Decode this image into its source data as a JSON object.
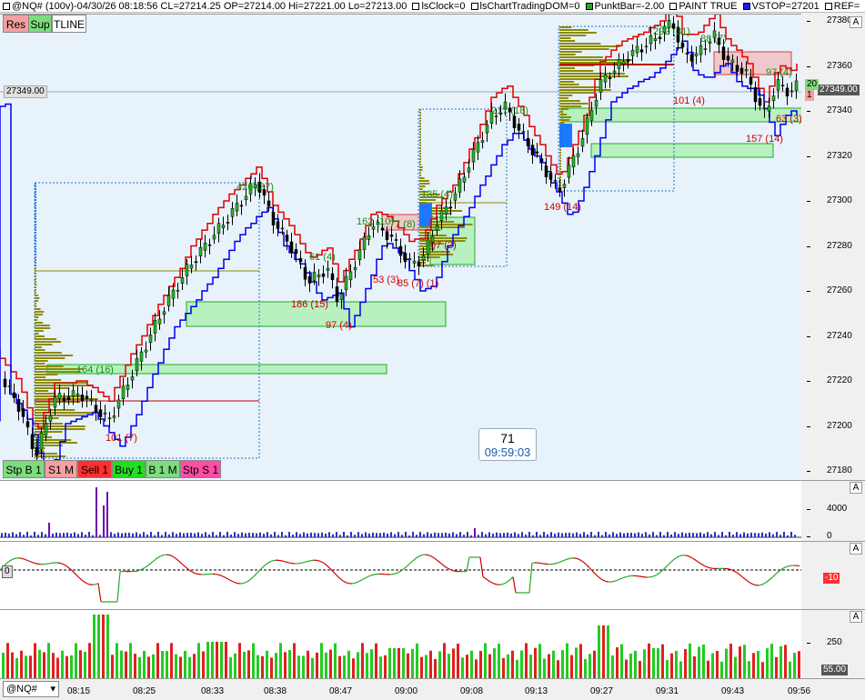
{
  "info_bar": {
    "symbol_text": "@NQ# (100v)-04/30/26 08:18:56 CL=27214.25 OP=27214.00 Hi=27221.00 Lo=27213.00",
    "items": [
      {
        "label": "lsClock=0",
        "color": "#ffffff"
      },
      {
        "label": "lsChartTradingDOM=0",
        "color": "#ffffff"
      },
      {
        "label": "PunktBar=-2.00",
        "color": "#22aa22"
      },
      {
        "label": "PAINT TRUE",
        "color": "#ffffff"
      },
      {
        "label": "VSTOP=27201",
        "color": "#1a1aff"
      },
      {
        "label": "REF=",
        "color": "#ffffff"
      }
    ]
  },
  "top_buttons": [
    {
      "label": "Res",
      "color": "#f4a0a0"
    },
    {
      "label": "Sup",
      "color": "#7ddc7d"
    },
    {
      "label": "TLINE",
      "color": "#ffffff"
    }
  ],
  "order_buttons": [
    {
      "label": "Stp B 1",
      "color": "#7ddc7d"
    },
    {
      "label": "S1 M",
      "color": "#f4a0a0"
    },
    {
      "label": "Sell 1",
      "color": "#ff3030"
    },
    {
      "label": "Buy 1",
      "color": "#22dd22"
    },
    {
      "label": "B 1 M",
      "color": "#7ddc7d"
    },
    {
      "label": "Stp S 1",
      "color": "#ff4da6"
    }
  ],
  "timer": {
    "count": "71",
    "time": "09:59:03"
  },
  "price_marker": "27349.00",
  "last_price": "27349.00",
  "right_tags": {
    "green": "20",
    "pink": "1"
  },
  "price_axis": {
    "ticks": [
      "27380",
      "27360",
      "27340",
      "27320",
      "27300",
      "27280",
      "27260",
      "27240",
      "27220",
      "27200",
      "27180"
    ],
    "button": "A"
  },
  "delta_axis": {
    "ticks": [
      "4000",
      "0"
    ],
    "button": "A"
  },
  "osc_axis": {
    "tag": "-10",
    "button": "A",
    "left_tag": "0"
  },
  "vol_axis": {
    "ticks": [
      "250"
    ],
    "tag": "55.00",
    "button": "A"
  },
  "swing_labels": [
    {
      "text": "426 (37)",
      "color": "green"
    },
    {
      "text": "164 (16)",
      "color": "green"
    },
    {
      "text": "101 (7)",
      "color": "red"
    },
    {
      "text": "61 (4)",
      "color": "green"
    },
    {
      "text": "186 (15)",
      "color": "red"
    },
    {
      "text": "97 (4)",
      "color": "red"
    },
    {
      "text": "162 (10)",
      "color": "green"
    },
    {
      "text": "77 (8)",
      "color": "green"
    },
    {
      "text": "53 (3)",
      "color": "red"
    },
    {
      "text": "85 (7) (1)",
      "color": "red"
    },
    {
      "text": "67 (2)",
      "color": "red"
    },
    {
      "text": "135 (4)",
      "color": "green"
    },
    {
      "text": "217 (18)",
      "color": "green"
    },
    {
      "text": "149 (14)",
      "color": "red"
    },
    {
      "text": "292 (31)",
      "color": "green"
    },
    {
      "text": "88 (7)",
      "color": "green"
    },
    {
      "text": "101 (4)",
      "color": "red"
    },
    {
      "text": "97 (4)",
      "color": "green"
    },
    {
      "text": "157 (14)",
      "color": "red"
    },
    {
      "text": "63 (3)",
      "color": "red"
    }
  ],
  "symbol_select": "@NQ#",
  "time_axis": [
    "08:15",
    "08:25",
    "08:33",
    "08:38",
    "08:47",
    "09:00",
    "09:08",
    "09:13",
    "09:27",
    "09:31",
    "09:43",
    "09:56"
  ]
}
